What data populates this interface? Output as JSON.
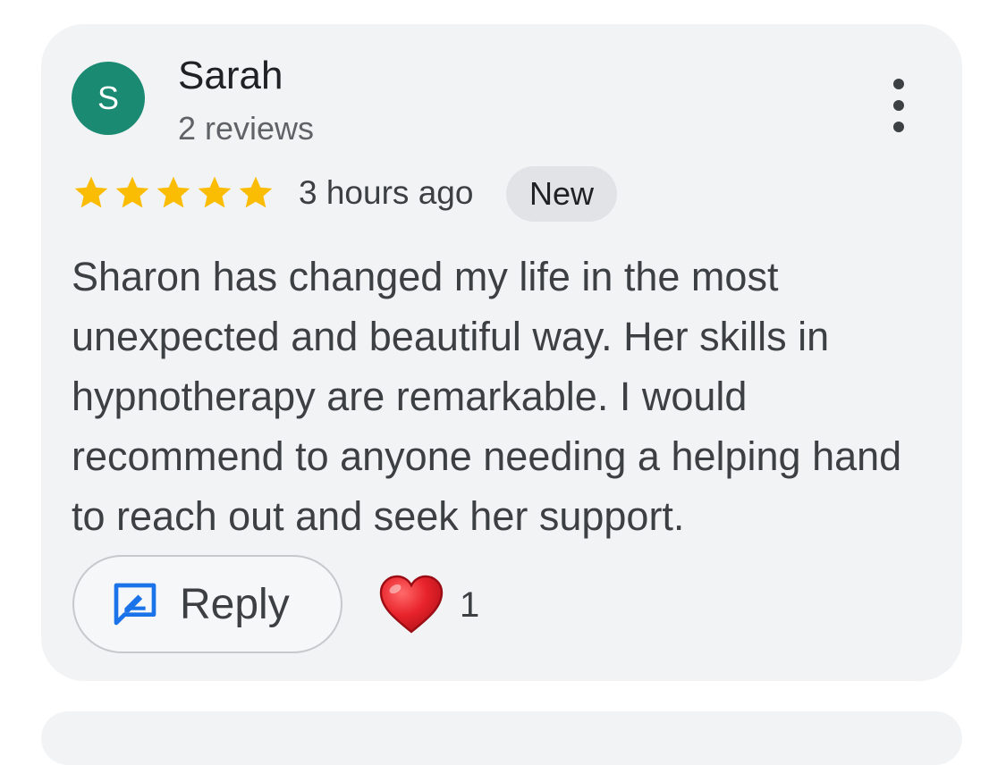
{
  "review": {
    "author_initial": "S",
    "author_name": "Sarah",
    "author_meta": "2 reviews",
    "rating": 5,
    "rating_max": 5,
    "time_ago": "3 hours ago",
    "badge": "New",
    "text": "Sharon has changed my life in the most unexpected and beautiful way. Her skills in hypnotherapy are remarkable. I would recommend to anyone needing a helping hand to reach out and seek her support.",
    "reply_label": "Reply",
    "reaction_count": "1"
  },
  "icons": {
    "more": "more-vertical-icon",
    "star": "star-icon",
    "reply": "reply-icon",
    "heart": "heart-icon"
  },
  "colors": {
    "avatar_bg": "#1a8a72",
    "star": "#fbbc04",
    "reply_icon": "#1a73e8",
    "heart": "#e0232b",
    "card_bg": "#f2f3f5",
    "badge_bg": "#e1e3e6"
  }
}
